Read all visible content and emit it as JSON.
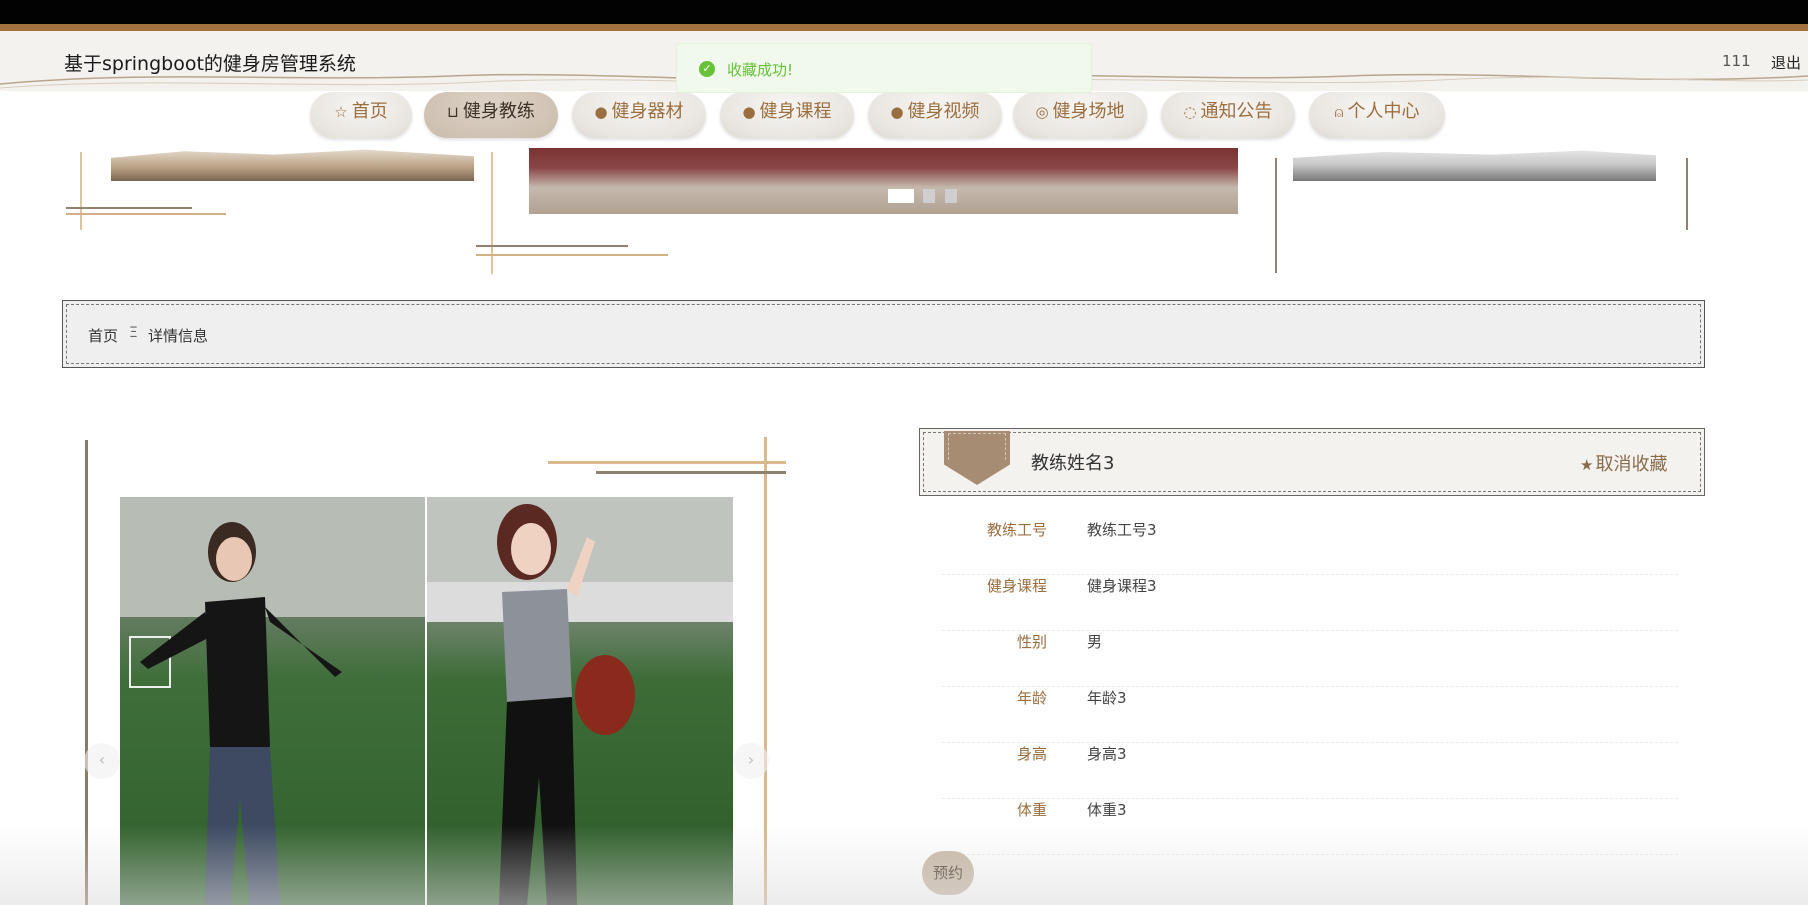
{
  "header": {
    "site_title": "基于springboot的健身房管理系统",
    "username": "111",
    "logout_label": "退出"
  },
  "toast": {
    "message": "收藏成功!",
    "icon": "check-circle-icon"
  },
  "nav": {
    "items": [
      {
        "label": "首页",
        "icon": "star-outline-icon",
        "active": false
      },
      {
        "label": "健身教练",
        "icon": "bag-icon",
        "active": true
      },
      {
        "label": "健身器材",
        "icon": "alert-icon",
        "active": false
      },
      {
        "label": "健身课程",
        "icon": "question-icon",
        "active": false
      },
      {
        "label": "健身视频",
        "icon": "info-icon",
        "active": false
      },
      {
        "label": "健身场地",
        "icon": "target-icon",
        "active": false
      },
      {
        "label": "通知公告",
        "icon": "trend-icon",
        "active": false
      },
      {
        "label": "个人中心",
        "icon": "user-icon",
        "active": false
      }
    ]
  },
  "carousel": {
    "slide_count": 3,
    "active_slide": 1
  },
  "breadcrumb": {
    "home": "首页",
    "separator": "Ξ",
    "current": "详情信息"
  },
  "gallery": {
    "prev_label": "‹",
    "next_label": "›"
  },
  "detail": {
    "name": "教练姓名3",
    "fav_label": "取消收藏",
    "fav_icon": "star-icon",
    "fields": [
      {
        "label": "教练工号",
        "value": "教练工号3"
      },
      {
        "label": "健身课程",
        "value": "健身课程3"
      },
      {
        "label": "性别",
        "value": "男"
      },
      {
        "label": "年龄",
        "value": "年龄3"
      },
      {
        "label": "身高",
        "value": "身高3"
      },
      {
        "label": "体重",
        "value": "体重3"
      }
    ],
    "book_label": "预约"
  },
  "colors": {
    "accent": "#9a6e3f",
    "toast_green": "#67c23a",
    "top_bar": "#020202",
    "top_accent": "#a2733e"
  }
}
